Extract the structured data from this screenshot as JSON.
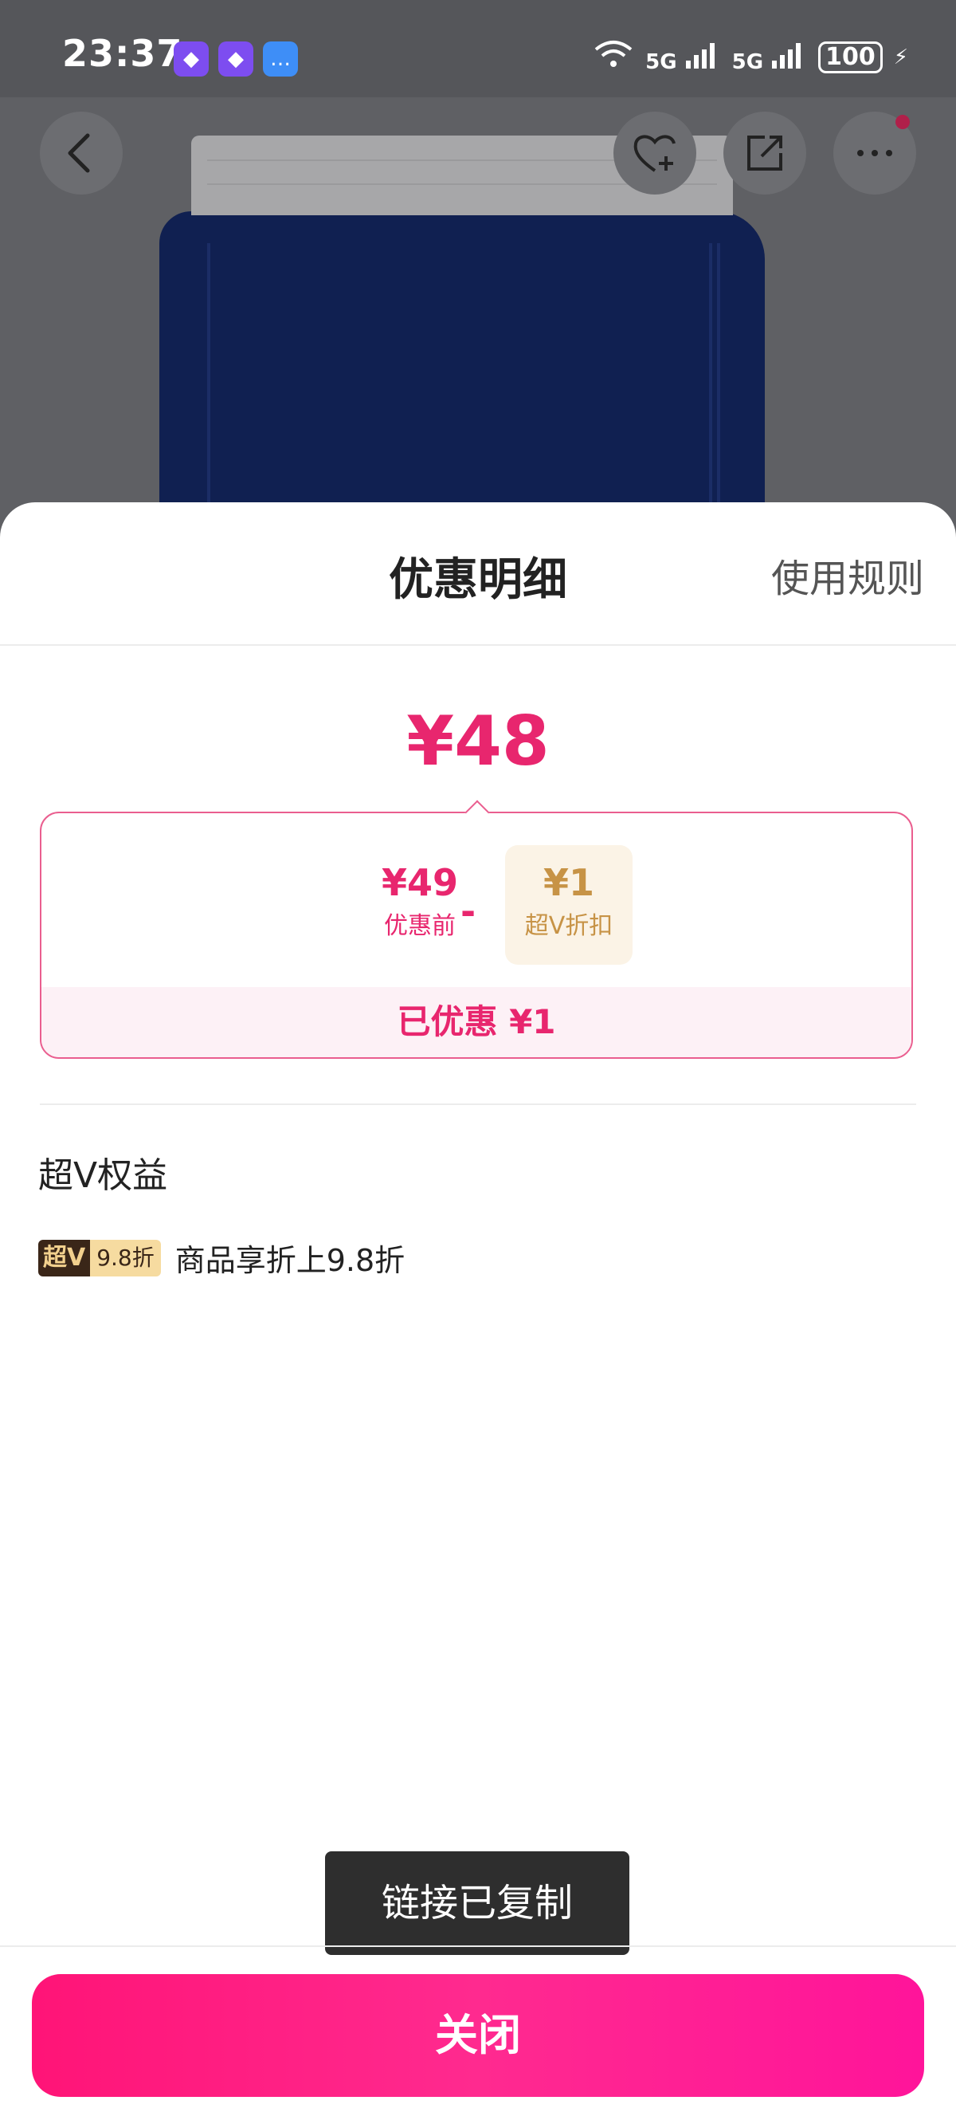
{
  "status_bar": {
    "time": "23:37",
    "battery": "100",
    "network": "5G"
  },
  "nav": {
    "back_icon": "chevron-left-icon",
    "favorite_icon": "heart-plus-icon",
    "share_icon": "share-icon",
    "more_icon": "more-dots-icon"
  },
  "sheet": {
    "title": "优惠明细",
    "rules_link": "使用规则",
    "final_price": "¥48",
    "original_price": "¥49",
    "original_label": "优惠前",
    "minus": "-",
    "discount_amount": "¥1",
    "discount_label": "超V折扣",
    "saved_text": "已优惠 ¥1",
    "section_title": "超V权益",
    "benefit": {
      "badge_v": "超V",
      "badge_rate": "9.8折",
      "text": "商品享折上9.8折"
    }
  },
  "toast": "链接已复制",
  "close_button": "关闭",
  "colors": {
    "accent": "#e8266e",
    "button": "#ff1a85",
    "gold": "#c79346"
  }
}
